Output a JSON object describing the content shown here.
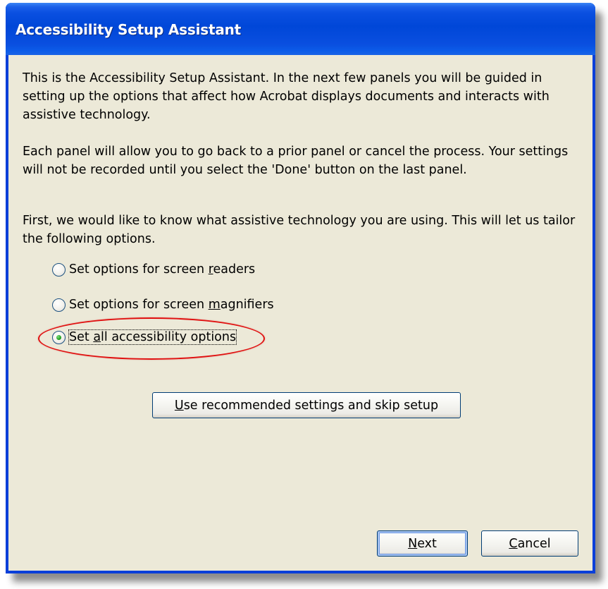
{
  "window": {
    "title": "Accessibility Setup Assistant"
  },
  "intro": {
    "paragraph1": "This is the Accessibility Setup Assistant. In the next few panels you will be guided in setting up the options that affect how Acrobat displays documents and interacts with assistive technology.",
    "paragraph2": "Each panel will allow you to go back to a prior panel or cancel the process. Your settings will not be recorded until you select the 'Done' button on the last panel.",
    "paragraph3": "First, we would like to know what assistive technology you are using. This will let us tailor the following options."
  },
  "options": [
    {
      "before": "Set options for screen ",
      "mnemonic": "r",
      "after": "eaders",
      "checked": false
    },
    {
      "before": "Set options for screen ",
      "mnemonic": "m",
      "after": "agnifiers",
      "checked": false
    },
    {
      "before": "Set ",
      "mnemonic": "a",
      "after": "ll accessibility options",
      "checked": true
    }
  ],
  "buttons": {
    "skip": {
      "mnemonic": "U",
      "rest": "se recommended settings and skip setup"
    },
    "next": {
      "mnemonic": "N",
      "rest": "ext"
    },
    "cancel": {
      "mnemonic": "C",
      "rest": "ancel"
    }
  },
  "colors": {
    "titlebar": "#0047d8",
    "dialog_bg": "#ece9d8",
    "highlight_ellipse": "#e01010",
    "radio_checked_dot": "#21a121"
  }
}
